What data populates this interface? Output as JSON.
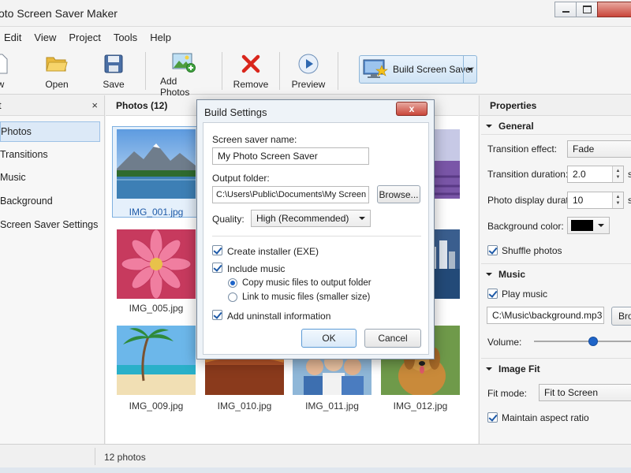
{
  "window": {
    "title": "oto Screen Saver Maker"
  },
  "menu": [
    "Edit",
    "View",
    "Project",
    "Tools",
    "Help"
  ],
  "toolbar": {
    "new_label": "w",
    "open_label": "Open",
    "save_label": "Save",
    "add_photos_label": "Add Photos",
    "remove_label": "Remove",
    "preview_label": "Preview",
    "build_label": "Build Screen Saver"
  },
  "left_panel": {
    "title": "t",
    "close_glyph": "×",
    "items": [
      "Photos",
      "Transitions",
      "Music",
      "Background",
      "Screen Saver Settings"
    ]
  },
  "photos": {
    "title": "Photos  (12)",
    "labels": [
      "IMG_001.jpg",
      "jpg",
      "IMG_005.jpg",
      "jpg",
      "IMG_009.jpg",
      "IMG_010.jpg",
      "IMG_011.jpg",
      "IMG_012.jpg"
    ]
  },
  "properties": {
    "title": "Properties",
    "general": {
      "heading": "General",
      "transition_effect_label": "Transition effect:",
      "transition_effect_value": "Fade",
      "transition_duration_label": "Transition duration:",
      "transition_duration_value": "2.0",
      "transition_duration_unit": "s",
      "photo_display_label": "Photo display duration:",
      "photo_display_value": "10",
      "photo_display_unit": "s",
      "bg_color_label": "Background color:",
      "bg_color_value": "#000000",
      "shuffle_label": "Shuffle photos",
      "shuffle_checked": true
    },
    "music": {
      "heading": "Music",
      "play_label": "Play music",
      "play_checked": true,
      "path": "C:\\Music\\background.mp3",
      "browse_label": "Bro",
      "volume_label": "Volume:",
      "volume_level": 0.6
    },
    "image_fit": {
      "heading": "Image Fit",
      "fit_mode_label": "Fit mode:",
      "fit_mode_value": "Fit to Screen",
      "aspect_label": "Maintain aspect ratio",
      "aspect_checked": true
    }
  },
  "status": {
    "text": "12 photos"
  },
  "dialog": {
    "title": "Build Settings",
    "close_glyph": "x",
    "name_label": "Screen saver name:",
    "name_value": "My Photo Screen Saver",
    "output_label": "Output folder:",
    "output_value": "C:\\Users\\Public\\Documents\\My Screen Savers",
    "browse_label": "Browse...",
    "quality_label": "Quality:",
    "quality_value": "High (Recommended)",
    "create_installer_label": "Create installer (EXE)",
    "include_music_label": "Include music",
    "copy_music_label": "Copy music files to output folder",
    "link_music_label": "Link to music files (smaller size)",
    "uninstall_label": "Add uninstall information",
    "ok_label": "OK",
    "cancel_label": "Cancel"
  }
}
